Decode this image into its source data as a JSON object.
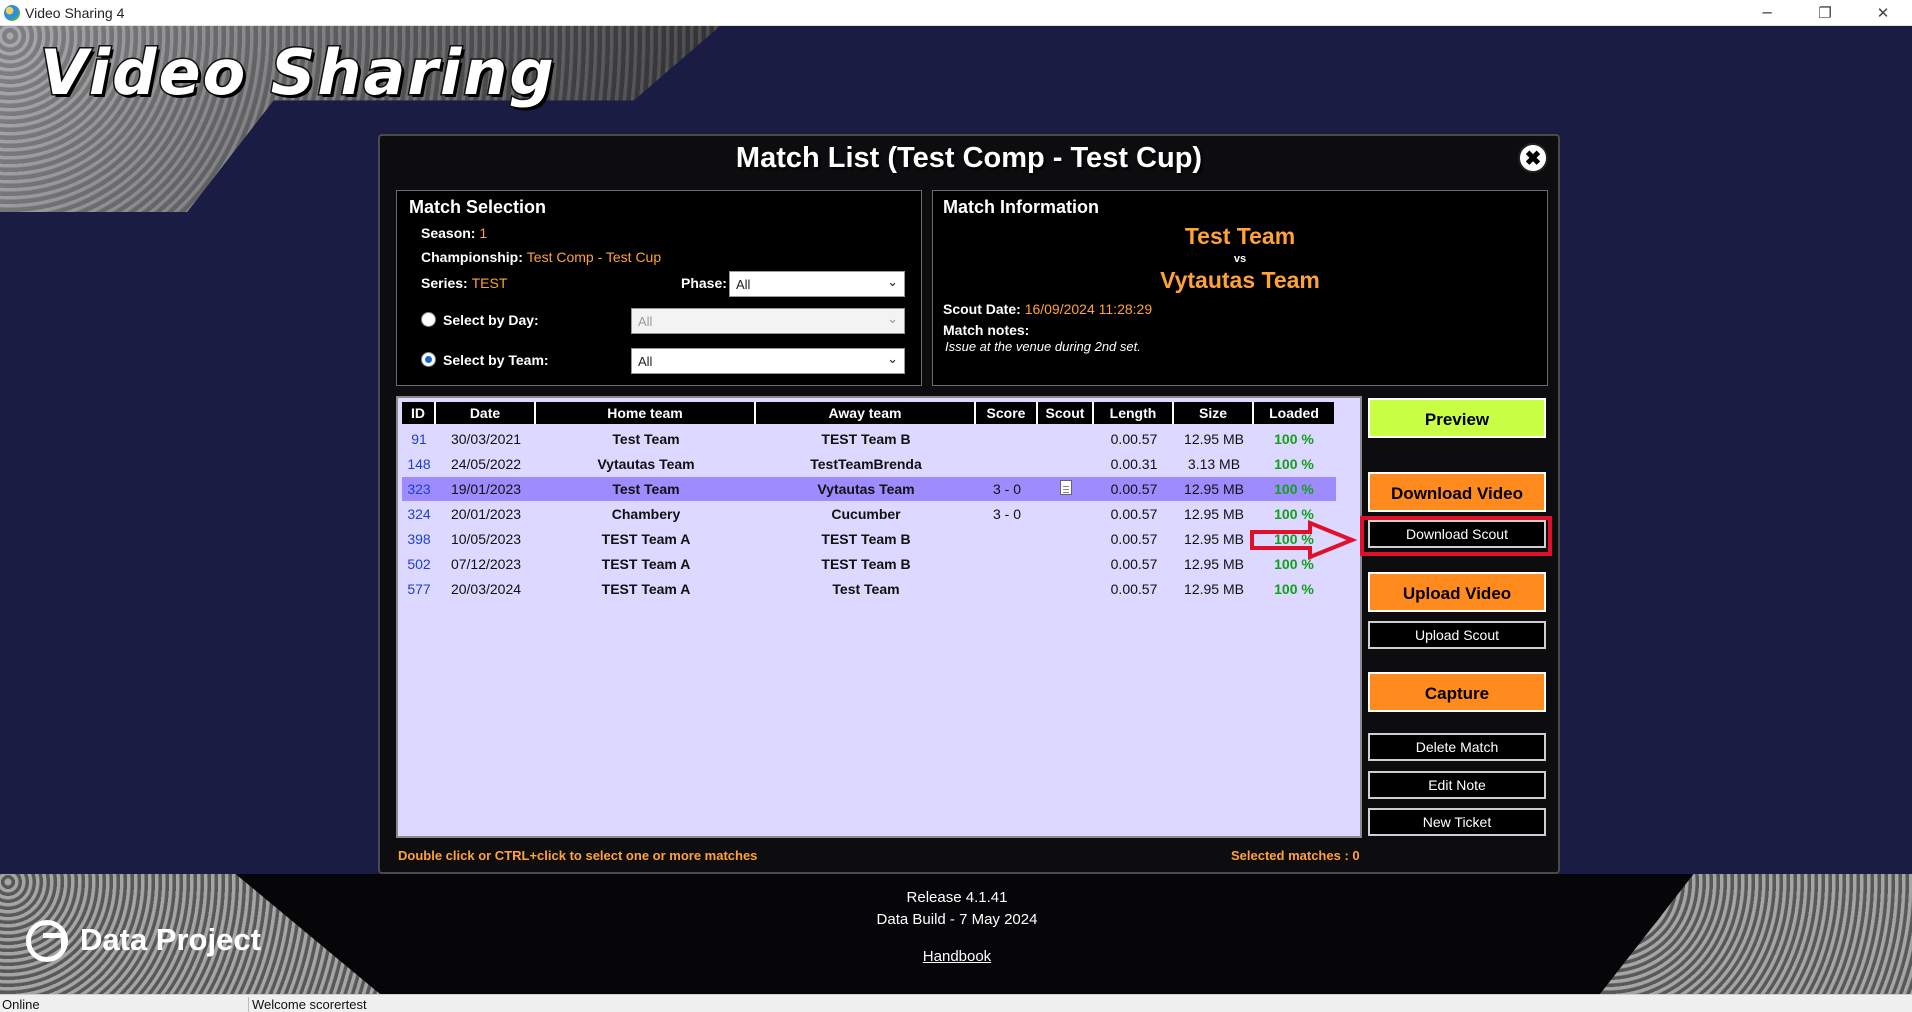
{
  "window": {
    "title": "Video Sharing 4",
    "controls": [
      "─",
      "❐",
      "✕"
    ]
  },
  "brand": {
    "app_name": "Video Sharing",
    "company": "Data Project"
  },
  "dialog": {
    "title": "Match List (Test Comp - Test Cup)",
    "close_glyph": "✖"
  },
  "match_selection": {
    "heading": "Match Selection",
    "season_label": "Season:",
    "season_value": "1",
    "championship_label": "Championship:",
    "championship_value": "Test Comp - Test Cup",
    "series_label": "Series:",
    "series_value": "TEST",
    "phase_label": "Phase:",
    "phase_value": "All",
    "select_by_day_label": "Select by Day:",
    "select_by_day_value": "All",
    "select_by_team_label": "Select by Team:",
    "select_by_team_value": "All"
  },
  "match_information": {
    "heading": "Match Information",
    "home": "Test Team",
    "vs": "vs",
    "away": "Vytautas Team",
    "scout_date_label": "Scout Date:",
    "scout_date_value": "16/09/2024 11:28:29",
    "notes_label": "Match notes:",
    "notes_value": "Issue at the venue during 2nd set."
  },
  "table": {
    "columns": [
      "ID",
      "Date",
      "Home team",
      "Away team",
      "Score",
      "Scout",
      "Length",
      "Size",
      "Loaded"
    ],
    "rows": [
      {
        "id": "91",
        "date": "30/03/2021",
        "home": "Test Team",
        "away": "TEST Team B",
        "score": "",
        "scout": false,
        "length": "0.00.57",
        "size": "12.95 MB",
        "loaded": "100 %"
      },
      {
        "id": "148",
        "date": "24/05/2022",
        "home": "Vytautas Team",
        "away": "TestTeamBrenda",
        "score": "",
        "scout": false,
        "length": "0.00.31",
        "size": "3.13 MB",
        "loaded": "100 %"
      },
      {
        "id": "323",
        "date": "19/01/2023",
        "home": "Test Team",
        "away": "Vytautas Team",
        "score": "3 - 0",
        "scout": true,
        "length": "0.00.57",
        "size": "12.95 MB",
        "loaded": "100 %"
      },
      {
        "id": "324",
        "date": "20/01/2023",
        "home": "Chambery",
        "away": "Cucumber",
        "score": "3 - 0",
        "scout": false,
        "length": "0.00.57",
        "size": "12.95 MB",
        "loaded": "100 %"
      },
      {
        "id": "398",
        "date": "10/05/2023",
        "home": "TEST Team A",
        "away": "TEST Team B",
        "score": "",
        "scout": false,
        "length": "0.00.57",
        "size": "12.95 MB",
        "loaded": "100 %"
      },
      {
        "id": "502",
        "date": "07/12/2023",
        "home": "TEST Team A",
        "away": "TEST Team B",
        "score": "",
        "scout": false,
        "length": "0.00.57",
        "size": "12.95 MB",
        "loaded": "100 %"
      },
      {
        "id": "577",
        "date": "20/03/2024",
        "home": "TEST Team A",
        "away": "Test Team",
        "score": "",
        "scout": false,
        "length": "0.00.57",
        "size": "12.95 MB",
        "loaded": "100 %"
      }
    ],
    "selected_row_id": "323"
  },
  "buttons": {
    "preview": "Preview",
    "download_video": "Download Video",
    "download_scout": "Download Scout",
    "upload_video": "Upload Video",
    "upload_scout": "Upload Scout",
    "capture": "Capture",
    "delete_match": "Delete Match",
    "edit_note": "Edit Note",
    "new_ticket": "New Ticket"
  },
  "hints": {
    "selection_help": "Double click or CTRL+click to select one or more matches",
    "selected_count": "Selected matches : 0"
  },
  "footer": {
    "release": "Release 4.1.41",
    "data_build": "Data Build - 7 May 2024",
    "handbook": "Handbook"
  },
  "status": {
    "connection": "Online",
    "message": "Welcome scorertest"
  },
  "colors": {
    "accent_orange": "#ff8a1d",
    "accent_green": "#c9ff45",
    "highlight_red": "#e0102a",
    "selected_row": "#9e8cff"
  }
}
